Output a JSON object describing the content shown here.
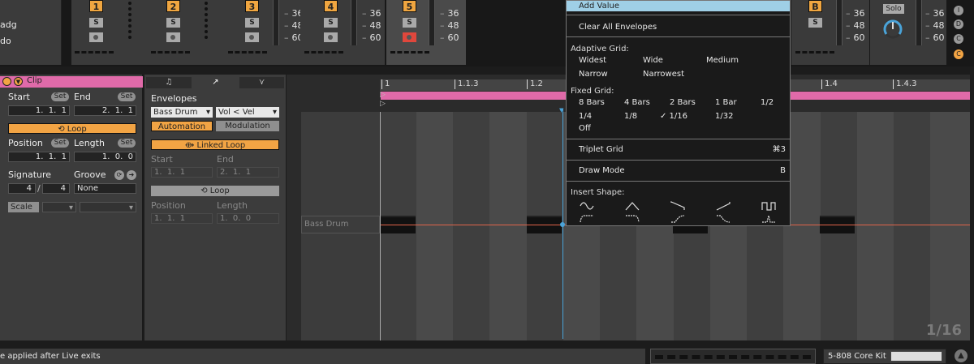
{
  "tracks": {
    "left_names": [
      "adg",
      "do"
    ],
    "numbers": [
      "1",
      "2",
      "3",
      "4",
      "5",
      "B"
    ],
    "solo_label": "S",
    "db_ticks": [
      "36",
      "48",
      "60"
    ],
    "solo_button": "Solo"
  },
  "clip": {
    "title": "Clip",
    "start_label": "Start",
    "end_label": "End",
    "set_label": "Set",
    "start_value": "1.  1.  1",
    "end_value": "2.  1.  1",
    "loop_label": "Loop",
    "position_label": "Position",
    "length_label": "Length",
    "position_value": "1.  1.  1",
    "length_value": "1.  0.  0",
    "signature_label": "Signature",
    "groove_label": "Groove",
    "sig_num": "4",
    "sig_slash": "/",
    "sig_den": "4",
    "groove_value": "None",
    "scale_label": "Scale"
  },
  "envelopes": {
    "tabs": [
      "♫",
      "↗",
      "⋎"
    ],
    "title": "Envelopes",
    "device": "Bass Drum",
    "param": "Vol < Vel",
    "automation_label": "Automation",
    "modulation_label": "Modulation",
    "linked_loop_label": "Linked Loop",
    "start_label": "Start",
    "end_label": "End",
    "start_value": "1.  1.  1",
    "end_value": "2.  1.  1",
    "loop_label": "Loop",
    "position_label": "Position",
    "length_label": "Length",
    "position_value": "1.  1.  1",
    "length_value": "1.  0.  0"
  },
  "editor": {
    "ruler": [
      "1",
      "1.1.3",
      "1.2",
      "1.4",
      "1.4.3"
    ],
    "lane_label": "Bass Drum",
    "page": "1/16"
  },
  "menu": {
    "add_value": "Add Value",
    "clear_envelopes": "Clear All Envelopes",
    "adaptive_header": "Adaptive Grid:",
    "adaptive": [
      "Widest",
      "Wide",
      "Medium",
      "Narrow",
      "Narrowest"
    ],
    "fixed_header": "Fixed Grid:",
    "fixed": [
      "8 Bars",
      "4 Bars",
      "2 Bars",
      "1 Bar",
      "1/2",
      "1/4",
      "1/8",
      "✓ 1/16",
      "1/32",
      "Off"
    ],
    "triplet": "Triplet Grid",
    "triplet_shortcut": "⌘3",
    "draw_mode": "Draw Mode",
    "draw_shortcut": "B",
    "insert_header": "Insert Shape:"
  },
  "right": {
    "dots": [
      "I",
      "D",
      "C"
    ]
  },
  "status": {
    "message": "e applied after Live exits",
    "kit_name": "5-808 Core Kit"
  },
  "colors": {
    "accent_orange": "#f2a444",
    "clip_pink": "#e06aa9",
    "cursor_blue": "#4aa3d8",
    "menu_highlight": "#9fcfe6"
  }
}
